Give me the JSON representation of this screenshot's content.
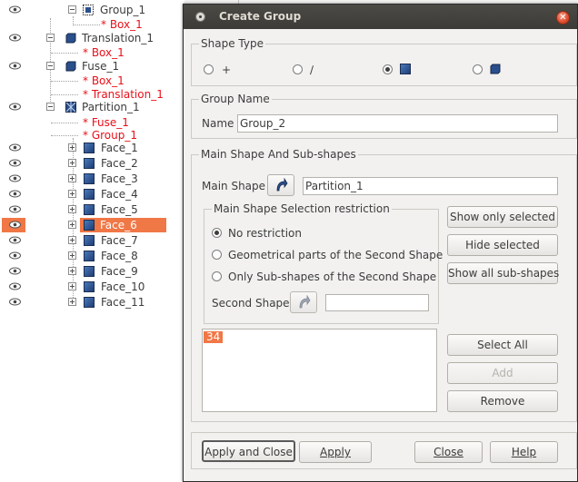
{
  "tree": {
    "rows": [
      {
        "label": "Group_1",
        "red": false,
        "eye": true
      },
      {
        "label": "* Box_1",
        "red": true,
        "eye": false
      },
      {
        "label": "Translation_1",
        "red": false,
        "eye": true
      },
      {
        "label": "* Box_1",
        "red": true,
        "eye": false
      },
      {
        "label": "Fuse_1",
        "red": false,
        "eye": true
      },
      {
        "label": "* Box_1",
        "red": true,
        "eye": false
      },
      {
        "label": "* Translation_1",
        "red": true,
        "eye": false
      },
      {
        "label": "Partition_1",
        "red": false,
        "eye": true
      },
      {
        "label": "* Fuse_1",
        "red": true,
        "eye": false
      },
      {
        "label": "* Group_1",
        "red": true,
        "eye": false
      },
      {
        "label": "Face_1",
        "red": false,
        "eye": true
      },
      {
        "label": "Face_2",
        "red": false,
        "eye": true
      },
      {
        "label": "Face_3",
        "red": false,
        "eye": true
      },
      {
        "label": "Face_4",
        "red": false,
        "eye": true
      },
      {
        "label": "Face_5",
        "red": false,
        "eye": true
      },
      {
        "label": "Face_6",
        "red": false,
        "eye": true,
        "selected": true
      },
      {
        "label": "Face_7",
        "red": false,
        "eye": true
      },
      {
        "label": "Face_8",
        "red": false,
        "eye": true
      },
      {
        "label": "Face_9",
        "red": false,
        "eye": true
      },
      {
        "label": "Face_10",
        "red": false,
        "eye": true
      },
      {
        "label": "Face_11",
        "red": false,
        "eye": true
      }
    ]
  },
  "dialog": {
    "title": "Create Group",
    "close_glyph": "✕",
    "shape_type": {
      "title": "Shape Type",
      "options": [
        {
          "icon": "point-icon",
          "glyph": "+",
          "selected": false
        },
        {
          "icon": "edge-icon",
          "glyph": "∕",
          "selected": false
        },
        {
          "icon": "face-icon",
          "selected": true
        },
        {
          "icon": "solid-icon",
          "selected": false
        }
      ]
    },
    "group_name": {
      "title": "Group Name",
      "name_label": "Name",
      "name_value": "Group_2"
    },
    "main_shape": {
      "title": "Main Shape And Sub-shapes",
      "main_shape_label": "Main Shape",
      "main_shape_value": "Partition_1",
      "restriction": {
        "title": "Main Shape Selection restriction",
        "options": [
          {
            "label": "No restriction",
            "selected": true
          },
          {
            "label": "Geometrical parts of the Second Shape",
            "selected": false
          },
          {
            "label": "Only Sub-shapes of the Second Shape",
            "selected": false
          }
        ],
        "second_shape_label": "Second Shape",
        "second_shape_value": ""
      },
      "show_only_selected": "Show only selected",
      "hide_selected": "Hide selected",
      "show_all_subshapes": "Show all sub-shapes",
      "ids": [
        "34"
      ],
      "select_all": "Select All",
      "add": "Add",
      "remove": "Remove"
    },
    "footer": {
      "apply_and_close": "Apply and Close",
      "apply": "Apply",
      "close": "Close",
      "help": "Help"
    }
  },
  "colors": {
    "selection": "#f07746",
    "title_bar": "#3c3b37",
    "red_text": "#e8101a",
    "dialog_bg": "#f2f1f0"
  }
}
